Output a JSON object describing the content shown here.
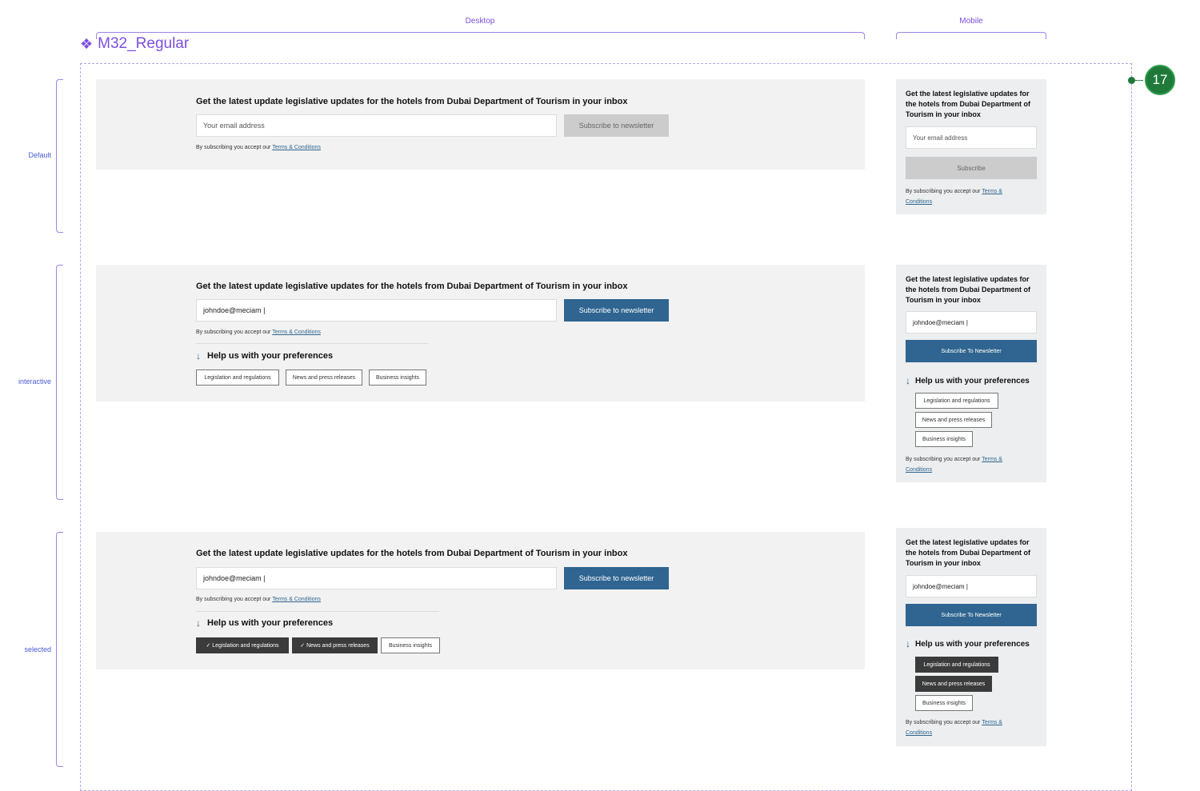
{
  "component_name": "M32_Regular",
  "columns": {
    "desktop": "Desktop",
    "mobile": "Mobile"
  },
  "rows": {
    "default": "Default",
    "interactive": "interactive",
    "selected": "selected"
  },
  "badge": "17",
  "heading": "Get the latest update legislative updates for the hotels from Dubai Department of Tourism in your inbox",
  "mobile_heading": "Get the latest legislative updates for the hotels from Dubai Department of Tourism in your inbox",
  "email_placeholder": "Your email address",
  "email_value": "johndoe@meciam |",
  "subscribe_desktop": "Subscribe to newsletter",
  "subscribe_mobile_default": "Subscribe",
  "subscribe_mobile": "Subscribe To Newsletter",
  "terms_prefix": "By subscribing you accept our",
  "terms_link": "Terms & Conditions",
  "preferences_title": "Help us with your preferences",
  "chips": [
    "Legislation and regulations",
    "News and press releases",
    "Business insights"
  ],
  "chips_selected": [
    "✓ Legislation and regulations",
    "✓ News and press releases",
    "Business insights"
  ],
  "colors": {
    "accent": "#2f6590",
    "selected_chip": "#3b3b3b",
    "badge": "#1f7a3a",
    "annotation": "#7B4FE0"
  }
}
